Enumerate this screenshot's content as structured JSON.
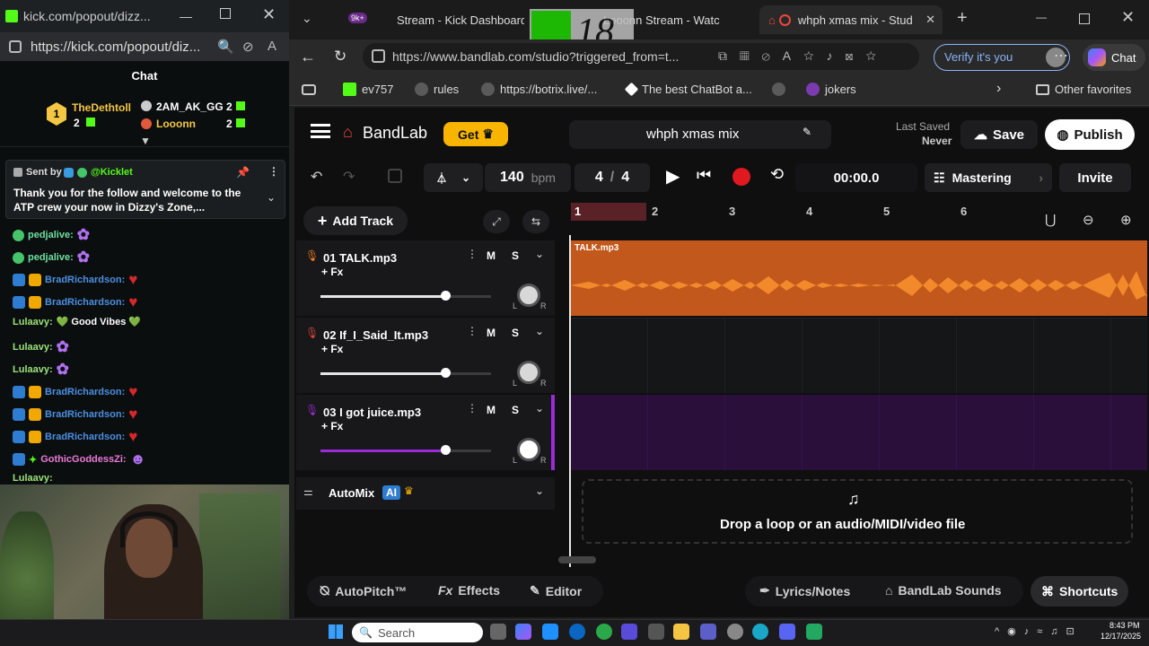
{
  "kick": {
    "window_title": "kick.com/popout/dizz...",
    "url": "https://kick.com/popout/diz...",
    "chat_header": "Chat",
    "leaderboard": [
      {
        "rank": "1",
        "name": "TheDethtoll",
        "count": "2"
      },
      {
        "rank": "",
        "name": "2AM_AK_GG",
        "count": "2"
      },
      {
        "rank": "",
        "name": "Looonn",
        "count": "2"
      }
    ],
    "pinned": {
      "sent_by_label": "Sent by",
      "sender": "@Kicklet",
      "text": "Thank you for the follow and welcome to the ATP crew your now in Dizzy's Zone,..."
    },
    "messages": [
      {
        "user": "pedjalive:",
        "text": "",
        "color": "#6ee0a0"
      },
      {
        "user": "pedjalive:",
        "text": "",
        "color": "#6ee0a0"
      },
      {
        "user": "BradRichardson:",
        "text": "",
        "color": "#4c8fe0"
      },
      {
        "user": "BradRichardson:",
        "text": "",
        "color": "#4c8fe0"
      },
      {
        "user": "Lulaavy:",
        "text": "💚 Good Vibes 💚",
        "color": "#9be37a"
      },
      {
        "user": "Lulaavy:",
        "text": "",
        "color": "#9be37a"
      },
      {
        "user": "Lulaavy:",
        "text": "",
        "color": "#9be37a"
      },
      {
        "user": "BradRichardson:",
        "text": "",
        "color": "#4c8fe0"
      },
      {
        "user": "BradRichardson:",
        "text": "",
        "color": "#4c8fe0"
      },
      {
        "user": "BradRichardson:",
        "text": "",
        "color": "#4c8fe0"
      },
      {
        "user": "GothicGoddessZi:",
        "text": "",
        "color": "#e97bd9"
      },
      {
        "user": "Lulaavy:",
        "text": "",
        "color": "#9be37a"
      }
    ]
  },
  "browser": {
    "tabs": [
      {
        "label": "Stream - Kick Dashboard"
      },
      {
        "label": "Looonn Stream - Watc"
      },
      {
        "label": "whph xmas mix - Stud"
      }
    ],
    "tab_badge": "9k+",
    "overlay_text": "18",
    "url": "https://www.bandlab.com/studio?triggered_from=t...",
    "verify_label": "Verify it's you",
    "chat_label": "Chat",
    "favorites": [
      {
        "label": "ev757"
      },
      {
        "label": "rules"
      },
      {
        "label": "https://botrix.live/..."
      },
      {
        "label": "The best ChatBot a..."
      },
      {
        "label": ""
      },
      {
        "label": "jokers"
      }
    ],
    "other_favorites": "Other favorites"
  },
  "bandlab": {
    "logo": "BandLab",
    "get_label": "Get",
    "project_title": "whph xmas mix",
    "last_saved_label": "Last Saved",
    "last_saved_value": "Never",
    "save_label": "Save",
    "publish_label": "Publish",
    "bpm_value": "140",
    "bpm_unit": "bpm",
    "time_sig_num": "4",
    "time_sig_den": "4",
    "time": "00:00.0",
    "mastering_label": "Mastering",
    "invite_label": "Invite",
    "add_track_label": "Add Track",
    "ruler": [
      "1",
      "2",
      "3",
      "4",
      "5",
      "6"
    ],
    "tracks": [
      {
        "name": "01  TALK.mp3",
        "fx": "+ Fx",
        "mute": "M",
        "solo": "S",
        "color": "#f47b20",
        "clip": "TALK.mp3",
        "pan_l": "L",
        "pan_r": "R"
      },
      {
        "name": "02  If_I_Said_It.mp3",
        "fx": "+ Fx",
        "mute": "M",
        "solo": "S",
        "color": "#e0453a",
        "clip": "",
        "pan_l": "L",
        "pan_r": "R"
      },
      {
        "name": "03  I got juice.mp3",
        "fx": "+ Fx",
        "mute": "M",
        "solo": "S",
        "color": "#9a2bd6",
        "clip": "",
        "pan_l": "L",
        "pan_r": "R"
      }
    ],
    "automix_label": "AutoMix",
    "ai_label": "AI",
    "drop_label": "Drop a loop or an audio/MIDI/video file",
    "bottom": {
      "autopitch": "AutoPitch™",
      "effects": "Effects",
      "editor": "Editor",
      "lyrics": "Lyrics/Notes",
      "sounds": "BandLab Sounds",
      "shortcuts": "Shortcuts"
    }
  },
  "taskbar": {
    "search_placeholder": "Search",
    "time": "8:43 PM",
    "date": "12/17/2025"
  }
}
